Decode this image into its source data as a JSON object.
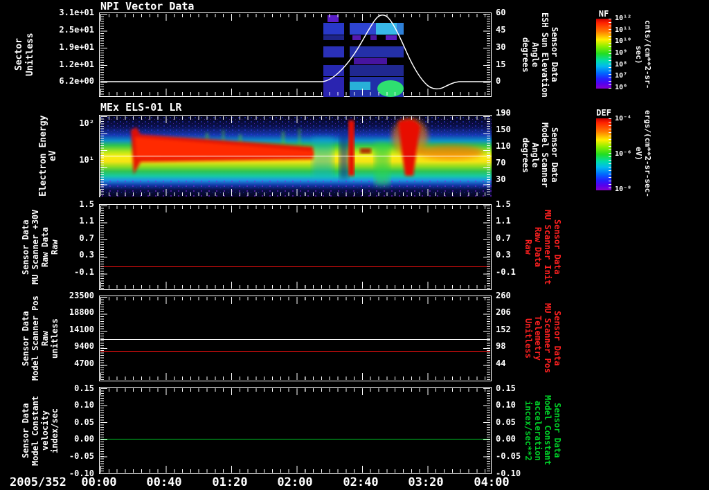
{
  "window": {
    "background": "#000000",
    "foreground": "#ffffff"
  },
  "xaxis": {
    "date_label": "2005/352",
    "tick_labels": [
      "00:00",
      "00:40",
      "01:20",
      "02:00",
      "02:40",
      "03:20",
      "04:00"
    ]
  },
  "colorbars": [
    {
      "name": "NF",
      "unit": "cnts/(cm**2-sr-sec)",
      "tick_labels": [
        "10¹²",
        "10¹¹",
        "10¹⁰",
        "10⁹",
        "10⁸",
        "10⁷",
        "10⁶"
      ]
    },
    {
      "name": "DEF",
      "unit": "ergs/(cm**2-sr-sec-eV)",
      "tick_labels": [
        "10⁻⁴",
        "10⁻⁶",
        "10⁻⁸"
      ]
    }
  ],
  "panels": [
    {
      "title": "NPI Vector Data",
      "left_label": "Sector\nUnitless",
      "left_ticks": [
        "3.1e+01",
        "2.5e+01",
        "1.9e+01",
        "1.2e+01",
        "6.2e+00"
      ],
      "right_ticks": [
        "60",
        "45",
        "30",
        "15",
        "0"
      ],
      "right_label": "Sensor Data\nESH Sun Elevation\nAngle\ndegrees",
      "right_label_color": "#ffffff"
    },
    {
      "title": "MEx ELS-01 LR",
      "left_label": "Electron Energy\neV",
      "left_ticks": [
        "10²",
        "10¹"
      ],
      "right_ticks": [
        "190",
        "150",
        "110",
        "70",
        "30"
      ],
      "right_label": "Sensor Data\nModel Scanner\nAngle\ndegrees",
      "right_label_color": "#ffffff"
    },
    {
      "left_label": "Sensor Data\nMU Scanner +30V\nRaw Data\nRaw",
      "left_ticks": [
        "1.5",
        "1.1",
        "0.7",
        "0.3",
        "-0.1"
      ],
      "right_ticks": [
        "1.5",
        "1.1",
        "0.7",
        "0.3",
        "-0.1"
      ],
      "right_label": "Sensor Data\nMU Scanner Init\nRaw Data\nRaw",
      "right_label_color": "#ff2020"
    },
    {
      "left_label": "Sensor Data\nModel Scanner Pos\nRaw\nunitless",
      "left_ticks": [
        "23500",
        "18800",
        "14100",
        "9400",
        "4700"
      ],
      "right_ticks": [
        "260",
        "206",
        "152",
        "98",
        "44"
      ],
      "right_label": "Sensor Data\nMU Scanner Pos\nTelemetry\nUnitless",
      "right_label_color": "#ff2020"
    },
    {
      "left_label": "Sensor Data\nModel Constant\nvelocity\nindex/sec",
      "left_ticks": [
        "0.15",
        "0.10",
        "0.05",
        "0.00",
        "-0.05",
        "-0.10"
      ],
      "right_ticks": [
        "0.15",
        "0.10",
        "0.05",
        "0.00",
        "-0.05",
        "-0.10"
      ],
      "right_label": "Sensor Data\nModel Constant\nacceleration\nincex/sec**2",
      "right_label_color": "#00d028"
    }
  ],
  "chart_data": [
    {
      "type": "spectrogram",
      "panel": 1,
      "title": "NPI Vector Data",
      "y_axis_left": {
        "label": "Sector Unitless",
        "ticks": [
          31,
          25,
          19,
          12,
          6.2
        ]
      },
      "y_axis_right": {
        "label": "Sensor Data ESH Sun Elevation Angle degrees",
        "ticks": [
          0,
          15,
          30,
          45,
          60
        ],
        "range": [
          -10,
          62
        ]
      },
      "colorbar": {
        "name": "NF",
        "unit": "cnts/(cm**2-sr-sec)",
        "range_log10": [
          6,
          12
        ]
      },
      "data_coverage": "blue/purple/cyan count blocks only between ~02:17 and ~03:05; green patch near bottom ~02:55-03:05",
      "overlay_line": {
        "name": "ESH Sun Elevation Angle",
        "color": "#ffffff",
        "x_time": [
          "00:00",
          "02:15",
          "02:30",
          "02:45",
          "02:50",
          "03:00",
          "03:10",
          "03:22",
          "03:38",
          "04:00"
        ],
        "y_deg": [
          0,
          0,
          22,
          52,
          60,
          48,
          18,
          -8,
          0,
          0
        ]
      }
    },
    {
      "type": "spectrogram",
      "panel": 2,
      "title": "MEx ELS-01 LR",
      "y_axis_left": {
        "label": "Electron Energy eV",
        "scale": "log",
        "ticks": [
          10,
          100
        ],
        "range": [
          3,
          180
        ]
      },
      "y_axis_right": {
        "label": "Sensor Data Model Scanner Angle degrees",
        "ticks": [
          30,
          70,
          110,
          150,
          190
        ]
      },
      "colorbar": {
        "name": "DEF",
        "unit": "ergs/(cm**2-sr-sec-eV)",
        "range_log10": [
          -8,
          -4
        ]
      },
      "features": [
        "continuous yellow/green flux band ~5-30 eV across full 00:00-04:00 interval",
        "intense red enhancement ~15-60 eV from ~00:20 to ~02:10",
        "narrow red bursts near 02:33 and 03:03-03:10 reaching ~150 eV",
        "white reference line at ~13 eV",
        "cyan/dark dropout columns near 02:13-02:25 and 02:50-03:00",
        "dark background with blue speckle above ~80 eV and purple speckle below ~5 eV"
      ]
    },
    {
      "type": "line",
      "panel": 3,
      "y_ticks": [
        1.5,
        1.1,
        0.7,
        0.3,
        -0.1
      ],
      "series": [
        {
          "name": "MU Scanner Init Raw Data Raw",
          "color": "#ff2020",
          "shape": "constant",
          "value": 0.03
        }
      ]
    },
    {
      "type": "line",
      "panel": 4,
      "y_ticks_left": [
        23500,
        18800,
        14100,
        9400,
        4700
      ],
      "y_ticks_right": [
        260,
        206,
        152,
        98,
        44
      ],
      "series": [
        {
          "name": "Model Scanner Pos Raw",
          "color": "#ffffff",
          "shape": "constant",
          "value_left_axis": 11400
        },
        {
          "name": "MU Scanner Pos Telemetry",
          "color": "#ff2020",
          "shape": "constant",
          "value_left_axis": 8000,
          "value_right_axis": 84
        }
      ]
    },
    {
      "type": "line",
      "panel": 5,
      "y_ticks": [
        0.15,
        0.1,
        0.05,
        0.0,
        -0.05,
        -0.1
      ],
      "series": [
        {
          "name": "Model Constant acceleration",
          "color": "#00d028",
          "shape": "constant",
          "value": 0.0
        }
      ]
    }
  ]
}
